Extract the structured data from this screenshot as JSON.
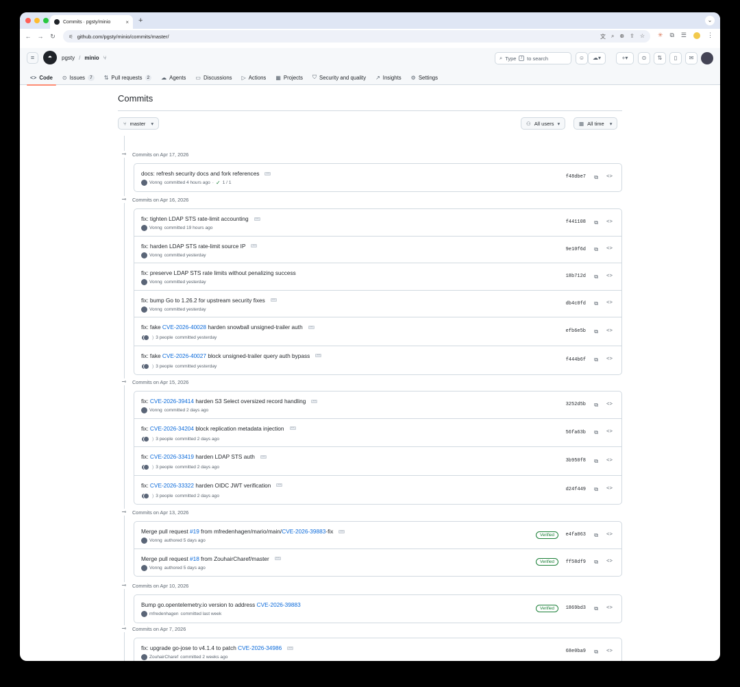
{
  "browser": {
    "tab_title": "Commits · pgsty/minio",
    "url": "github.com/pgsty/minio/commits/master/"
  },
  "header": {
    "owner": "pgsty",
    "repo": "minio",
    "search_type": "Type",
    "search_key": "/",
    "search_suffix": "to search"
  },
  "repo_nav": [
    {
      "label": "Code",
      "icon": "code-icon",
      "glyph": "<>",
      "active": true
    },
    {
      "label": "Issues",
      "icon": "issue-icon",
      "glyph": "⊙",
      "count": "7"
    },
    {
      "label": "Pull requests",
      "icon": "pull-request-icon",
      "glyph": "⇅",
      "count": "2"
    },
    {
      "label": "Agents",
      "icon": "agents-icon",
      "glyph": "☁"
    },
    {
      "label": "Discussions",
      "icon": "discussions-icon",
      "glyph": "▭"
    },
    {
      "label": "Actions",
      "icon": "actions-icon",
      "glyph": "▷"
    },
    {
      "label": "Projects",
      "icon": "projects-icon",
      "glyph": "▦"
    },
    {
      "label": "Security and quality",
      "icon": "shield-icon",
      "glyph": "⛉"
    },
    {
      "label": "Insights",
      "icon": "graph-icon",
      "glyph": "↗"
    },
    {
      "label": "Settings",
      "icon": "gear-icon",
      "glyph": "⚙"
    }
  ],
  "page": {
    "title": "Commits",
    "branch": "master",
    "users_filter": "All users",
    "time_filter": "All time"
  },
  "groups": [
    {
      "date": "Commits on Apr 17, 2026",
      "commits": [
        {
          "parts": [
            {
              "t": "docs: refresh security docs and fork references"
            }
          ],
          "ellipsis": true,
          "author": "Vonng",
          "action": "committed 4 hours ago",
          "status": "1 / 1",
          "sha": "f48dbe7"
        }
      ]
    },
    {
      "date": "Commits on Apr 16, 2026",
      "commits": [
        {
          "parts": [
            {
              "t": "fix: tighten LDAP STS rate-limit accounting"
            }
          ],
          "ellipsis": true,
          "author": "Vonng",
          "action": "committed 19 hours ago",
          "sha": "f441108"
        },
        {
          "parts": [
            {
              "t": "fix: harden LDAP STS rate-limit source IP"
            }
          ],
          "ellipsis": true,
          "author": "Vonng",
          "action": "committed yesterday",
          "sha": "9e10f6d"
        },
        {
          "parts": [
            {
              "t": "fix: preserve LDAP STS rate limits without penalizing success"
            }
          ],
          "ellipsis": false,
          "author": "Vonng",
          "action": "committed yesterday",
          "sha": "18b712d"
        },
        {
          "parts": [
            {
              "t": "fix: bump Go to 1.26.2 for upstream security fixes"
            }
          ],
          "ellipsis": true,
          "author": "Vonng",
          "action": "committed yesterday",
          "sha": "db4c0fd"
        },
        {
          "parts": [
            {
              "t": "fix: fake "
            },
            {
              "t": "CVE-2026-40028",
              "link": true
            },
            {
              "t": " harden snowball unsigned-trailer auth"
            }
          ],
          "ellipsis": true,
          "author": "3 people",
          "action": "committed yesterday",
          "multi": true,
          "sha": "efb6e5b"
        },
        {
          "parts": [
            {
              "t": "fix: fake "
            },
            {
              "t": "CVE-2026-40027",
              "link": true
            },
            {
              "t": " block unsigned-trailer query auth bypass"
            }
          ],
          "ellipsis": true,
          "author": "3 people",
          "action": "committed yesterday",
          "multi": true,
          "sha": "f444b6f"
        }
      ]
    },
    {
      "date": "Commits on Apr 15, 2026",
      "commits": [
        {
          "parts": [
            {
              "t": "fix: "
            },
            {
              "t": "CVE-2026-39414",
              "link": true
            },
            {
              "t": " harden S3 Select oversized record handling"
            }
          ],
          "ellipsis": true,
          "author": "Vonng",
          "action": "committed 2 days ago",
          "sha": "3252d5b"
        },
        {
          "parts": [
            {
              "t": "fix: "
            },
            {
              "t": "CVE-2026-34204",
              "link": true
            },
            {
              "t": " block replication metadata injection"
            }
          ],
          "ellipsis": true,
          "author": "3 people",
          "action": "committed 2 days ago",
          "multi": true,
          "sha": "56fa63b"
        },
        {
          "parts": [
            {
              "t": "fix: "
            },
            {
              "t": "CVE-2026-33419",
              "link": true
            },
            {
              "t": " harden LDAP STS auth"
            }
          ],
          "ellipsis": true,
          "author": "3 people",
          "action": "committed 2 days ago",
          "multi": true,
          "sha": "3b950f8"
        },
        {
          "parts": [
            {
              "t": "fix: "
            },
            {
              "t": "CVE-2026-33322",
              "link": true
            },
            {
              "t": " harden OIDC JWT verification"
            }
          ],
          "ellipsis": true,
          "author": "3 people",
          "action": "committed 2 days ago",
          "multi": true,
          "sha": "d24f449"
        }
      ]
    },
    {
      "date": "Commits on Apr 13, 2026",
      "commits": [
        {
          "parts": [
            {
              "t": "Merge pull request "
            },
            {
              "t": "#19",
              "link": true
            },
            {
              "t": " from mfredenhagen/mario/main/"
            },
            {
              "t": "CVE-2026-39883",
              "link": true
            },
            {
              "t": "-fix"
            }
          ],
          "ellipsis": true,
          "author": "Vonng",
          "action": "authored 5 days ago",
          "verified": "Verified",
          "sha": "e4fa063"
        },
        {
          "parts": [
            {
              "t": "Merge pull request "
            },
            {
              "t": "#18",
              "link": true
            },
            {
              "t": " from ZouhairCharef/master"
            }
          ],
          "ellipsis": true,
          "author": "Vonng",
          "action": "authored 5 days ago",
          "verified": "Verified",
          "sha": "ff58df9"
        }
      ]
    },
    {
      "date": "Commits on Apr 10, 2026",
      "commits": [
        {
          "parts": [
            {
              "t": "Bump go.opentelemetry.io version to address "
            },
            {
              "t": "CVE-2026-39883",
              "link": true
            }
          ],
          "ellipsis": false,
          "author": "mfredenhagen",
          "action": "committed last week",
          "verified": "Verified",
          "sha": "1869bd3"
        }
      ]
    },
    {
      "date": "Commits on Apr 7, 2026",
      "commits": [
        {
          "parts": [
            {
              "t": "fix: upgrade go-jose to v4.1.4 to patch "
            },
            {
              "t": "CVE-2026-34986",
              "link": true
            }
          ],
          "ellipsis": true,
          "author": "ZouhairCharef",
          "action": "committed 2 weeks ago",
          "sha": "68e0ba9"
        }
      ]
    }
  ],
  "colors": {
    "accent": "#0969da",
    "verified": "#1a7f37",
    "active_tab": "#fd8c73"
  }
}
